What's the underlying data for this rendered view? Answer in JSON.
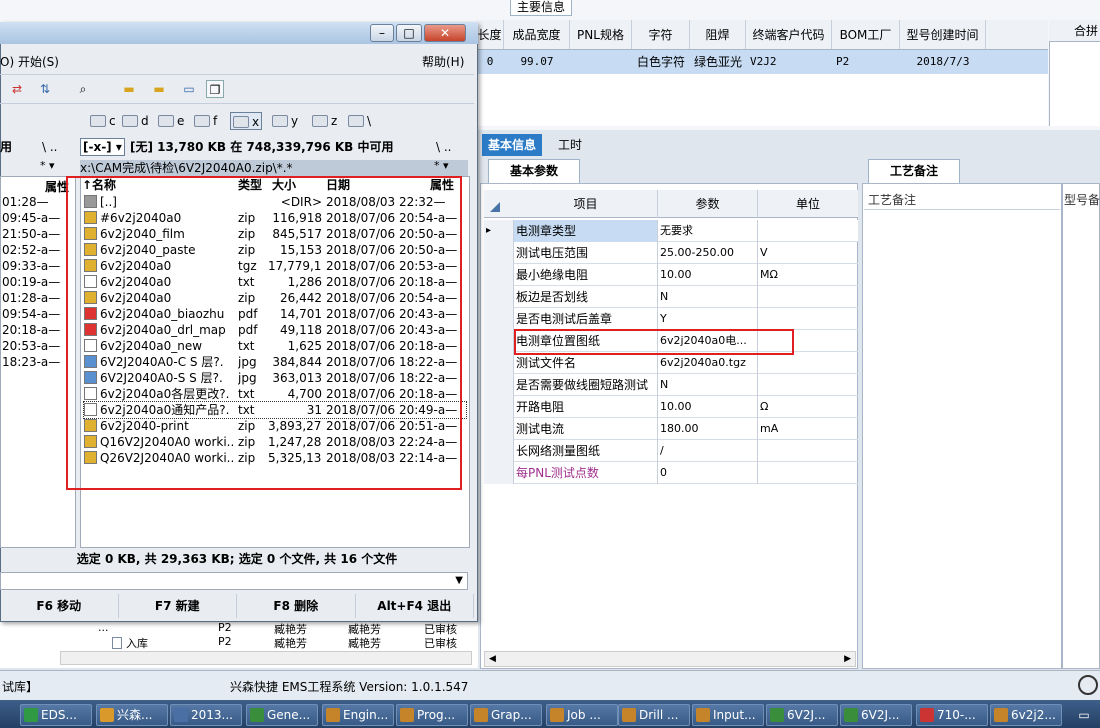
{
  "background_app": {
    "section_title": "主要信息",
    "grid_columns": [
      "长度",
      "成品宽度",
      "PNL规格",
      "字符",
      "阻焊",
      "终端客户代码",
      "BOM工厂",
      "型号创建时间"
    ],
    "grid_row": {
      "prefix": "0",
      "width": "99.07",
      "pnl": "",
      "char": "白色字符",
      "mask": "绿色亚光",
      "customer": "V2J2",
      "bom": "P2",
      "created": "2018/7/3"
    },
    "right_header": "合拼",
    "tabs": [
      "基本信息",
      "工时"
    ],
    "basic_params_tab": "基本参数",
    "param_headers": [
      "项目",
      "参数",
      "单位"
    ],
    "params": [
      {
        "item": "电测章类型",
        "value": "无要求",
        "unit": ""
      },
      {
        "item": "测试电压范围",
        "value": "25.00-250.00",
        "unit": "V"
      },
      {
        "item": "最小绝缘电阻",
        "value": "10.00",
        "unit": "MΩ"
      },
      {
        "item": "板边是否划线",
        "value": "N",
        "unit": ""
      },
      {
        "item": "是否电测试后盖章",
        "value": "Y",
        "unit": ""
      },
      {
        "item": "电测章位置图纸",
        "value": "6v2j2040a0电...",
        "unit": ""
      },
      {
        "item": "测试文件名",
        "value": "6v2j2040a0.tgz",
        "unit": ""
      },
      {
        "item": "是否需要做线圈短路测试",
        "value": "N",
        "unit": ""
      },
      {
        "item": "开路电阻",
        "value": "10.00",
        "unit": "Ω"
      },
      {
        "item": "测试电流",
        "value": "180.00",
        "unit": "mA"
      },
      {
        "item": "长网络测量图纸",
        "value": "/",
        "unit": ""
      },
      {
        "item": "每PNL测试点数",
        "value": "0",
        "unit": ""
      }
    ],
    "notes_tab": "工艺备注",
    "notes_header": "工艺备注",
    "model_header": "型号备",
    "tree_rows": [
      {
        "c1": "...",
        "c2": "P2",
        "c3": "臧艳芳",
        "c4": "臧艳芳",
        "c5": "已审核"
      },
      {
        "c1": "入库",
        "c2": "P2",
        "c3": "臧艳芳",
        "c4": "臧艳芳",
        "c5": "已审核"
      }
    ],
    "status_left": "试库】",
    "status_center": "兴森快捷 EMS工程系统 Version: 1.0.1.547"
  },
  "file_manager": {
    "menu_left": "O)  开始(S)",
    "menu_right": "帮助(H)",
    "drives": [
      "c",
      "d",
      "e",
      "f",
      "x",
      "y",
      "z",
      "\\"
    ],
    "path_left": "用",
    "drive_select": "[-x-]",
    "free_space": "[无]  13,780 KB 在 748,339,796 KB 中可用",
    "current_path": "x:\\CAM完成\\待检\\6V2J2040A0.zip\\*.*",
    "columns": [
      "↑名称",
      "类型",
      "大小",
      "日期",
      "属性"
    ],
    "left_header": "属性",
    "left_rows": [
      "01:28—",
      "09:45-a—",
      "21:50-a—",
      "02:52-a—",
      "09:33-a—",
      "00:19-a—",
      "01:28-a—",
      "09:54-a—",
      "20:18-a—",
      "20:53-a—",
      "18:23-a—"
    ],
    "files": [
      {
        "icon": "up",
        "name": "[..]",
        "type": "",
        "size": "<DIR>",
        "date": "2018/08/03 22:32—"
      },
      {
        "icon": "zip",
        "name": "#6v2j2040a0",
        "type": "zip",
        "size": "116,918",
        "date": "2018/07/06 20:54-a—"
      },
      {
        "icon": "zip",
        "name": "6v2j2040_film",
        "type": "zip",
        "size": "845,517",
        "date": "2018/07/06 20:50-a—"
      },
      {
        "icon": "zip",
        "name": "6v2j2040_paste",
        "type": "zip",
        "size": "15,153",
        "date": "2018/07/06 20:50-a—"
      },
      {
        "icon": "zip",
        "name": "6v2j2040a0",
        "type": "tgz",
        "size": "17,779,193",
        "date": "2018/07/06 20:53-a—"
      },
      {
        "icon": "txt",
        "name": "6v2j2040a0",
        "type": "txt",
        "size": "1,286",
        "date": "2018/07/06 20:18-a—"
      },
      {
        "icon": "zip",
        "name": "6v2j2040a0",
        "type": "zip",
        "size": "26,442",
        "date": "2018/07/06 20:54-a—"
      },
      {
        "icon": "pdf",
        "name": "6v2j2040a0_biaozhu",
        "type": "pdf",
        "size": "14,701",
        "date": "2018/07/06 20:43-a—"
      },
      {
        "icon": "pdf",
        "name": "6v2j2040a0_drl_map",
        "type": "pdf",
        "size": "49,118",
        "date": "2018/07/06 20:43-a—"
      },
      {
        "icon": "txt",
        "name": "6v2j2040a0_new",
        "type": "txt",
        "size": "1,625",
        "date": "2018/07/06 20:18-a—"
      },
      {
        "icon": "jpg",
        "name": "6V2J2040A0-C S 层?.",
        "type": "jpg",
        "size": "384,844",
        "date": "2018/07/06 18:22-a—"
      },
      {
        "icon": "jpg",
        "name": "6V2J2040A0-S S 层?.",
        "type": "jpg",
        "size": "363,013",
        "date": "2018/07/06 18:22-a—"
      },
      {
        "icon": "txt",
        "name": "6v2j2040a0各层更改?.",
        "type": "txt",
        "size": "4,700",
        "date": "2018/07/06 20:18-a—"
      },
      {
        "icon": "txt",
        "name": "6v2j2040a0通知产品?.",
        "type": "txt",
        "size": "31",
        "date": "2018/07/06 20:49-a—"
      },
      {
        "icon": "zip",
        "name": "6v2j2040-print",
        "type": "zip",
        "size": "3,893,271",
        "date": "2018/07/06 20:51-a—"
      },
      {
        "icon": "zip",
        "name": "Q16V2J2040A0 worki...",
        "type": "zip",
        "size": "1,247,282",
        "date": "2018/08/03 22:24-a—"
      },
      {
        "icon": "zip",
        "name": "Q26V2J2040A0 worki...",
        "type": "zip",
        "size": "5,325,135",
        "date": "2018/08/03 22:14-a—"
      }
    ],
    "status": "选定 0 KB, 共 29,363 KB; 选定 0 个文件, 共 16 个文件",
    "fkeys": [
      "F6 移动",
      "F7 新建",
      "F8 删除",
      "Alt+F4 退出"
    ]
  },
  "taskbar": [
    {
      "label": "EDS...",
      "color": "#2f9a43"
    },
    {
      "label": "兴森...",
      "color": "#d99a2b"
    },
    {
      "label": "2013...",
      "color": "#4a6fa5"
    },
    {
      "label": "Gene...",
      "color": "#3a8d3a"
    },
    {
      "label": "Engin...",
      "color": "#c6842a"
    },
    {
      "label": "Prog...",
      "color": "#c6842a"
    },
    {
      "label": "Grap...",
      "color": "#c6842a"
    },
    {
      "label": "Job ...",
      "color": "#c6842a"
    },
    {
      "label": "Drill ...",
      "color": "#c6842a"
    },
    {
      "label": "Input...",
      "color": "#c6842a"
    },
    {
      "label": "6V2J...",
      "color": "#3a8d3a"
    },
    {
      "label": "6V2J...",
      "color": "#3a8d3a"
    },
    {
      "label": "710-...",
      "color": "#c33"
    },
    {
      "label": "6v2j2...",
      "color": "#c6842a"
    }
  ]
}
